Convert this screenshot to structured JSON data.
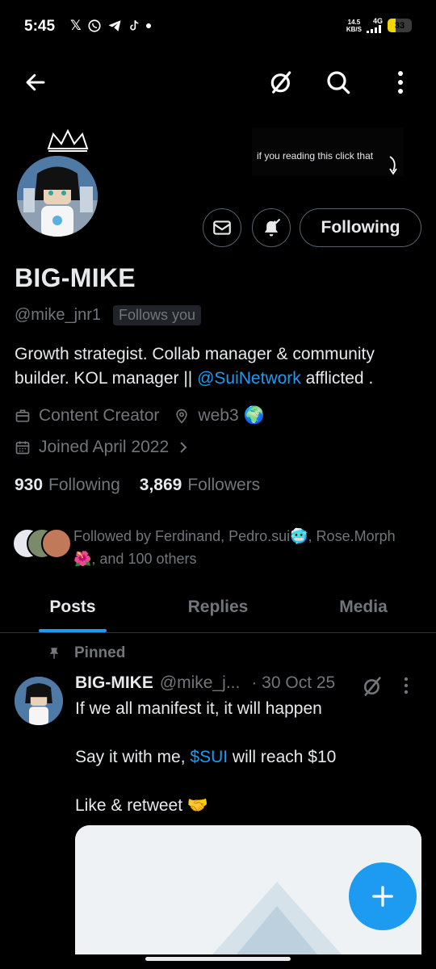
{
  "status_bar": {
    "time": "5:45",
    "speed_top": "14.5",
    "speed_bottom": "KB/S",
    "network": "4G",
    "battery": "33",
    "battery_level": 0.33,
    "icons": [
      "x-icon",
      "whatsapp-icon",
      "telegram-icon",
      "tiktok-icon"
    ]
  },
  "nav": {
    "icons": [
      "back-arrow-icon",
      "grok-icon",
      "search-icon",
      "more-vertical-icon"
    ]
  },
  "header": {
    "note": "if you reading this click that"
  },
  "profile": {
    "name": "BIG-MIKE",
    "handle": "@mike_jnr1",
    "follows_you": "Follows you",
    "following_label": "Following",
    "bio_part1": "Growth strategist. Collab manager & community builder. KOL manager || ",
    "bio_link": "@SuiNetwork",
    "bio_part2": " afflicted .",
    "profession": "Content Creator",
    "location": "web3 🌍",
    "joined": "Joined April 2022",
    "following_count": "930",
    "following_text": "Following",
    "followers_count": "3,869",
    "followers_text": "Followers",
    "followed_by": "Followed by Ferdinand, Pedro.sui🥶, Rose.Morph🌺, and 100 others"
  },
  "tabs": [
    {
      "label": "Posts",
      "active": true
    },
    {
      "label": "Replies",
      "active": false
    },
    {
      "label": "Media",
      "active": false
    }
  ],
  "post": {
    "pinned_label": "Pinned",
    "author_name": "BIG-MIKE",
    "author_handle": "@mike_j...",
    "date": "· 30 Oct 25",
    "line1": "If we all manifest it, it will happen",
    "line2_pre": "Say it with me, ",
    "line2_cashtag": "$SUI",
    "line2_post": " will reach $10",
    "line3": "Like & retweet 🤝"
  },
  "colors": {
    "accent": "#1d9bf0",
    "text_primary": "#e7e9ea",
    "text_secondary": "#71767b",
    "border": "#536471",
    "background": "#000000"
  }
}
